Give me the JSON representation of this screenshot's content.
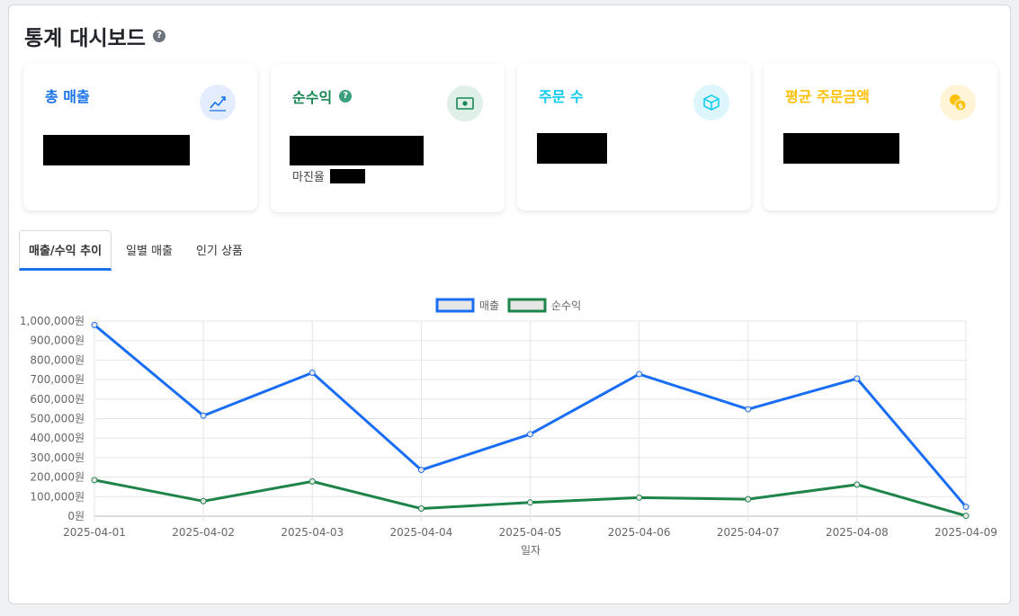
{
  "page": {
    "title": "통계 대시보드",
    "help": "?"
  },
  "cards": [
    {
      "label": "총 매출",
      "color": "#1a73e8",
      "icon": "chart-line-icon"
    },
    {
      "label": "순수익",
      "color": "#198754",
      "icon": "cash-icon",
      "sub_label": "마진율"
    },
    {
      "label": "주문 수",
      "color": "#0dcaf0",
      "icon": "box-icon"
    },
    {
      "label": "평균 주문금액",
      "color": "#ffc107",
      "icon": "coins-icon"
    }
  ],
  "tabs": [
    {
      "label": "매출/수익 추이",
      "active": true
    },
    {
      "label": "일별 매출",
      "active": false
    },
    {
      "label": "인기 상품",
      "active": false
    }
  ],
  "chart_data": {
    "type": "line",
    "x": [
      "2025-04-01",
      "2025-04-02",
      "2025-04-03",
      "2025-04-04",
      "2025-04-05",
      "2025-04-06",
      "2025-04-07",
      "2025-04-08",
      "2025-04-09"
    ],
    "series": [
      {
        "name": "매출",
        "color": "#1a6ef5",
        "values": [
          980000,
          515000,
          735000,
          237000,
          420000,
          728000,
          548000,
          705000,
          48000
        ]
      },
      {
        "name": "순수익",
        "color": "#1e8449",
        "values": [
          185000,
          77000,
          178000,
          39000,
          70000,
          95000,
          87000,
          162000,
          2000
        ]
      }
    ],
    "yticks": [
      "0원",
      "100,000원",
      "200,000원",
      "300,000원",
      "400,000원",
      "500,000원",
      "600,000원",
      "700,000원",
      "800,000원",
      "900,000원",
      "1,000,000원"
    ],
    "ylim": [
      0,
      1000000
    ],
    "xlabel": "일자",
    "grid": true,
    "legend": "top-center"
  }
}
